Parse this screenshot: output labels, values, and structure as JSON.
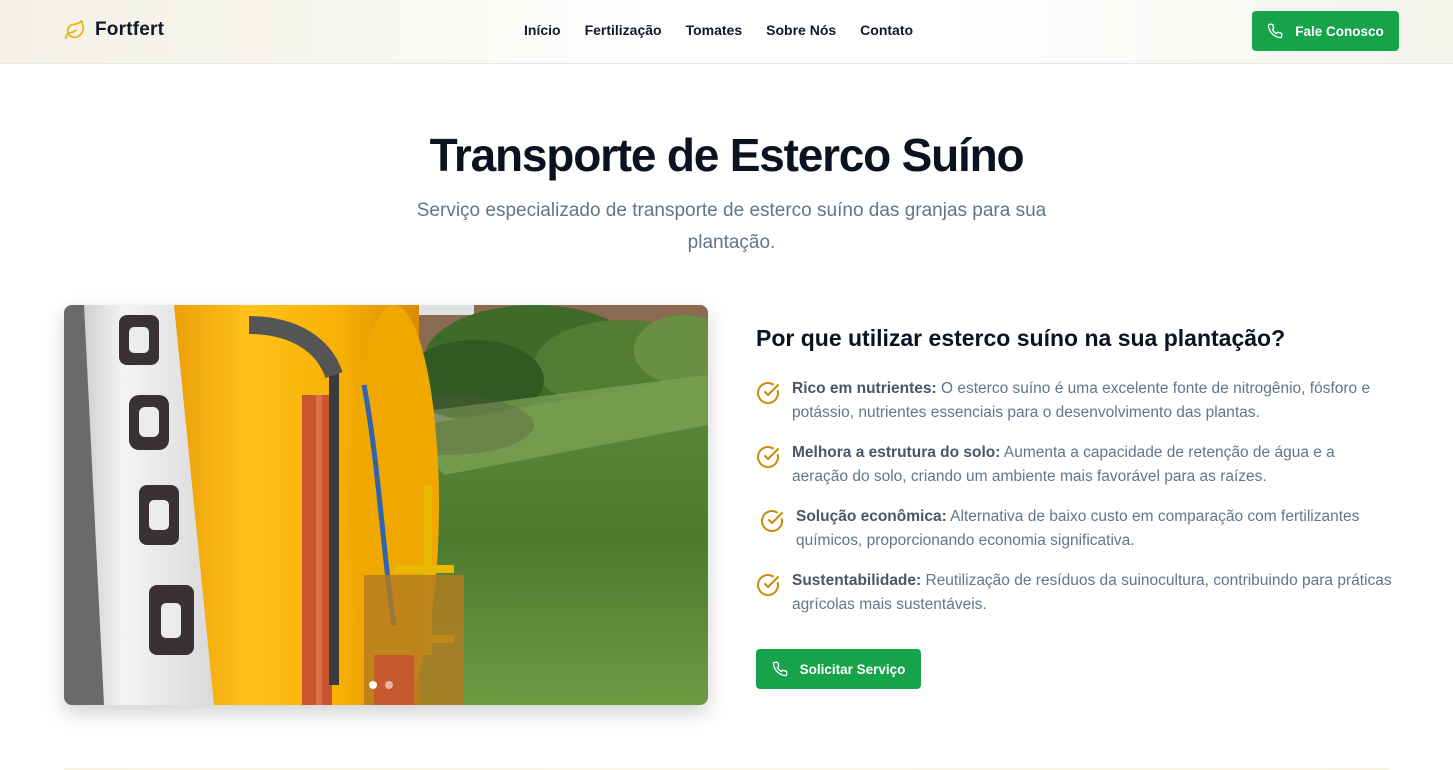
{
  "brand": {
    "name": "Fortfert",
    "icon": "leaf-icon",
    "accent": "#eab308"
  },
  "nav": {
    "items": [
      "Início",
      "Fertilização",
      "Tomates",
      "Sobre Nós",
      "Contato"
    ]
  },
  "header": {
    "cta_label": "Fale Conosco",
    "cta_icon": "phone-icon"
  },
  "hero": {
    "title": "Transporte de Esterco Suíno",
    "subtitle": "Serviço especializado de transporte de esterco suíno das granjas para sua plantação."
  },
  "gallery": {
    "slide_count": 2,
    "active_slide": 1
  },
  "benefits_section": {
    "title": "Por que utilizar esterco suíno na sua plantação?",
    "items": [
      {
        "label": "Rico em nutrientes:",
        "text": " O esterco suíno é uma excelente fonte de nitrogênio, fósforo e potássio, nutrientes essenciais para o desenvolvimento das plantas."
      },
      {
        "label": "Melhora a estrutura do solo:",
        "text": " Aumenta a capacidade de retenção de água e a aeração do solo, criando um ambiente mais favorável para as raízes."
      },
      {
        "label": "Solução econômica:",
        "text": " Alternativa de baixo custo em comparação com fertilizantes químicos, proporcionando economia significativa."
      },
      {
        "label": "Sustentabilidade:",
        "text": " Reutilização de resíduos da suinocultura, contribuindo para práticas agrícolas mais sustentáveis."
      }
    ],
    "cta_label": "Solicitar Serviço"
  },
  "colors": {
    "primary": "#16a34a",
    "check": "#ca8a04",
    "heading": "#0b1220",
    "muted": "#64748b"
  }
}
